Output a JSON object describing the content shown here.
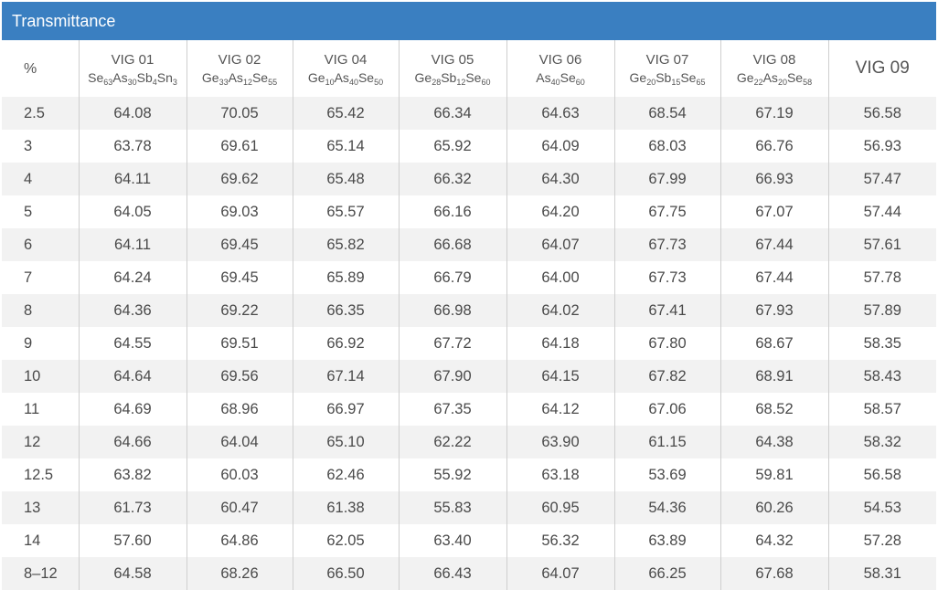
{
  "header": {
    "title": "Transmittance"
  },
  "chart_data": {
    "type": "table",
    "title": "Transmittance",
    "corner_label": "%",
    "columns": [
      {
        "name": "VIG 01",
        "formula": [
          [
            "Se",
            "63"
          ],
          [
            "As",
            "30"
          ],
          [
            "Sb",
            "4"
          ],
          [
            "Sn",
            "3"
          ]
        ]
      },
      {
        "name": "VIG 02",
        "formula": [
          [
            "Ge",
            "33"
          ],
          [
            "As",
            "12"
          ],
          [
            "Se",
            "55"
          ]
        ]
      },
      {
        "name": "VIG 04",
        "formula": [
          [
            "Ge",
            "10"
          ],
          [
            "As",
            "40"
          ],
          [
            "Se",
            "50"
          ]
        ]
      },
      {
        "name": "VIG 05",
        "formula": [
          [
            "Ge",
            "28"
          ],
          [
            "Sb",
            "12"
          ],
          [
            "Se",
            "60"
          ]
        ]
      },
      {
        "name": "VIG 06",
        "formula": [
          [
            "As",
            "40"
          ],
          [
            "Se",
            "60"
          ]
        ]
      },
      {
        "name": "VIG 07",
        "formula": [
          [
            "Ge",
            "20"
          ],
          [
            "Sb",
            "15"
          ],
          [
            "Se",
            "65"
          ]
        ]
      },
      {
        "name": "VIG 08",
        "formula": [
          [
            "Ge",
            "22"
          ],
          [
            "As",
            "20"
          ],
          [
            "Se",
            "58"
          ]
        ]
      },
      {
        "name": "VIG 09",
        "formula": []
      }
    ],
    "rows": [
      {
        "label": "2.5",
        "values": [
          "64.08",
          "70.05",
          "65.42",
          "66.34",
          "64.63",
          "68.54",
          "67.19",
          "56.58"
        ]
      },
      {
        "label": "3",
        "values": [
          "63.78",
          "69.61",
          "65.14",
          "65.92",
          "64.09",
          "68.03",
          "66.76",
          "56.93"
        ]
      },
      {
        "label": "4",
        "values": [
          "64.11",
          "69.62",
          "65.48",
          "66.32",
          "64.30",
          "67.99",
          "66.93",
          "57.47"
        ]
      },
      {
        "label": "5",
        "values": [
          "64.05",
          "69.03",
          "65.57",
          "66.16",
          "64.20",
          "67.75",
          "67.07",
          "57.44"
        ]
      },
      {
        "label": "6",
        "values": [
          "64.11",
          "69.45",
          "65.82",
          "66.68",
          "64.07",
          "67.73",
          "67.44",
          "57.61"
        ]
      },
      {
        "label": "7",
        "values": [
          "64.24",
          "69.45",
          "65.89",
          "66.79",
          "64.00",
          "67.73",
          "67.44",
          "57.78"
        ]
      },
      {
        "label": "8",
        "values": [
          "64.36",
          "69.22",
          "66.35",
          "66.98",
          "64.02",
          "67.41",
          "67.93",
          "57.89"
        ]
      },
      {
        "label": "9",
        "values": [
          "64.55",
          "69.51",
          "66.92",
          "67.72",
          "64.18",
          "67.80",
          "68.67",
          "58.35"
        ]
      },
      {
        "label": "10",
        "values": [
          "64.64",
          "69.56",
          "67.14",
          "67.90",
          "64.15",
          "67.82",
          "68.91",
          "58.43"
        ]
      },
      {
        "label": "11",
        "values": [
          "64.69",
          "68.96",
          "66.97",
          "67.35",
          "64.12",
          "67.06",
          "68.52",
          "58.57"
        ]
      },
      {
        "label": "12",
        "values": [
          "64.66",
          "64.04",
          "65.10",
          "62.22",
          "63.90",
          "61.15",
          "64.38",
          "58.32"
        ]
      },
      {
        "label": "12.5",
        "values": [
          "63.82",
          "60.03",
          "62.46",
          "55.92",
          "63.18",
          "53.69",
          "59.81",
          "56.58"
        ]
      },
      {
        "label": "13",
        "values": [
          "61.73",
          "60.47",
          "61.38",
          "55.83",
          "60.95",
          "54.36",
          "60.26",
          "54.53"
        ]
      },
      {
        "label": "14",
        "values": [
          "57.60",
          "64.86",
          "62.05",
          "63.40",
          "56.32",
          "63.89",
          "64.32",
          "57.28"
        ]
      },
      {
        "label": "8–12",
        "values": [
          "64.58",
          "68.26",
          "66.50",
          "66.43",
          "64.07",
          "66.25",
          "67.68",
          "58.31"
        ]
      }
    ]
  }
}
